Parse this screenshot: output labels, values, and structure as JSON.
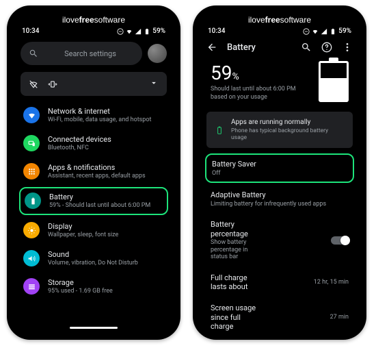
{
  "watermark": {
    "pre": "ilove",
    "mid": "free",
    "post": "software"
  },
  "status": {
    "time": "10:34",
    "battery": "59%"
  },
  "search": {
    "placeholder": "Search settings"
  },
  "settings": [
    {
      "icon": "wifi",
      "color": "#1a73e8",
      "title": "Network & internet",
      "sub": "Wi-Fi, mobile, data usage, and hotspot"
    },
    {
      "icon": "devices",
      "color": "#1ed760",
      "title": "Connected devices",
      "sub": "Bluetooth, NFC"
    },
    {
      "icon": "apps",
      "color": "#f28500",
      "title": "Apps & notifications",
      "sub": "Assistant, recent apps, default apps"
    },
    {
      "icon": "battery",
      "color": "#009688",
      "title": "Battery",
      "sub": "59% - Should last until about 6:00 PM",
      "highlight": true
    },
    {
      "icon": "display",
      "color": "#f9ab00",
      "title": "Display",
      "sub": "Wallpaper, sleep, font size"
    },
    {
      "icon": "sound",
      "color": "#00bcd4",
      "title": "Sound",
      "sub": "Volume, vibration, Do Not Disturb"
    },
    {
      "icon": "storage",
      "color": "#a142f4",
      "title": "Storage",
      "sub": "95% used - 1.69 GB free"
    }
  ],
  "screen2": {
    "title": "Battery",
    "pct": "59",
    "pct_sym": "%",
    "hero_sub": "Should last until about 6:00 PM based on your usage",
    "card": {
      "title": "Apps are running normally",
      "sub": "Phone has typical background battery usage"
    },
    "rows": [
      {
        "title": "Battery Saver",
        "sub": "Off",
        "highlight": true
      },
      {
        "title": "Adaptive Battery",
        "sub": "Limiting battery for infrequently used apps"
      },
      {
        "title": "Battery percentage",
        "sub": "Show battery percentage in status bar",
        "toggle": true
      },
      {
        "title": "Full charge lasts about",
        "val": "12 hr, 15 min"
      },
      {
        "title": "Screen usage since full charge",
        "val": "27 min"
      }
    ]
  }
}
